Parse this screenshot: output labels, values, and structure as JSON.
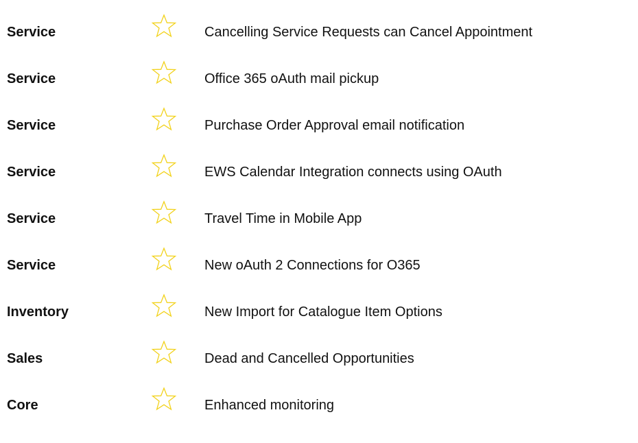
{
  "colors": {
    "star_outline": "#F2D21B",
    "text": "#111111",
    "background": "#FFFFFF"
  },
  "items": [
    {
      "category": "Service",
      "icon": "star-outline-icon",
      "description": "Cancelling Service Requests can Cancel Appointment"
    },
    {
      "category": "Service",
      "icon": "star-outline-icon",
      "description": "Office 365 oAuth mail pickup"
    },
    {
      "category": "Service",
      "icon": "star-outline-icon",
      "description": "Purchase Order Approval email notification"
    },
    {
      "category": "Service",
      "icon": "star-outline-icon",
      "description": "EWS Calendar Integration connects using OAuth"
    },
    {
      "category": "Service",
      "icon": "star-outline-icon",
      "description": "Travel Time in Mobile App"
    },
    {
      "category": "Service",
      "icon": "star-outline-icon",
      "description": "New oAuth 2 Connections for O365"
    },
    {
      "category": "Inventory",
      "icon": "star-outline-icon",
      "description": "New Import for Catalogue Item Options"
    },
    {
      "category": "Sales",
      "icon": "star-outline-icon",
      "description": "Dead and Cancelled Opportunities"
    },
    {
      "category": "Core",
      "icon": "star-outline-icon",
      "description": "Enhanced monitoring"
    }
  ]
}
